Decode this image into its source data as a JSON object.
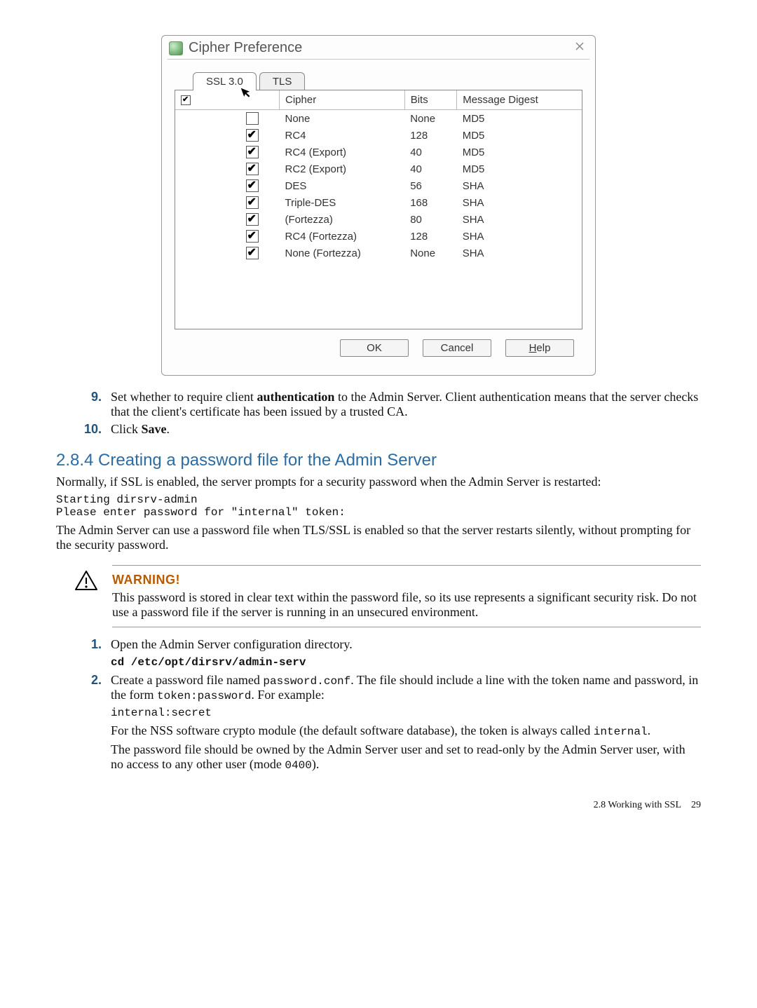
{
  "dialog": {
    "title": "Cipher Preference",
    "tabs": {
      "ssl": "SSL 3.0",
      "tls": "TLS"
    },
    "headers": {
      "select": "✓",
      "cipher": "Cipher",
      "bits": "Bits",
      "digest": "Message Digest"
    },
    "rows": [
      {
        "checked": false,
        "cipher": "None",
        "bits": "None",
        "digest": "MD5"
      },
      {
        "checked": true,
        "cipher": "RC4",
        "bits": "128",
        "digest": "MD5"
      },
      {
        "checked": true,
        "cipher": "RC4 (Export)",
        "bits": "40",
        "digest": "MD5"
      },
      {
        "checked": true,
        "cipher": "RC2 (Export)",
        "bits": "40",
        "digest": "MD5"
      },
      {
        "checked": true,
        "cipher": "DES",
        "bits": "56",
        "digest": "SHA"
      },
      {
        "checked": true,
        "cipher": "Triple-DES",
        "bits": "168",
        "digest": "SHA"
      },
      {
        "checked": true,
        "cipher": "(Fortezza)",
        "bits": "80",
        "digest": "SHA"
      },
      {
        "checked": true,
        "cipher": "RC4 (Fortezza)",
        "bits": "128",
        "digest": "SHA"
      },
      {
        "checked": true,
        "cipher": "None (Fortezza)",
        "bits": "None",
        "digest": "SHA"
      }
    ],
    "buttons": {
      "ok": "OK",
      "cancel": "Cancel",
      "help_pre": "H",
      "help_post": "elp"
    }
  },
  "steps_top": [
    {
      "n": "9.",
      "text_a": "Set whether to require client ",
      "bold": "authentication",
      "text_b": " to the Admin Server. Client authentication means that the server checks that the client's certificate has been issued by a trusted CA."
    },
    {
      "n": "10.",
      "text_a": "Click ",
      "bold": "Save",
      "text_b": "."
    }
  ],
  "section_title": "2.8.4 Creating a password file for the Admin Server",
  "para1": "Normally, if SSL is enabled, the server prompts for a security password when the Admin Server is restarted:",
  "code1": "Starting dirsrv-admin\nPlease enter password for \"internal\" token:",
  "para2": "The Admin Server can use a password file when TLS/SSL is enabled so that the server restarts silently, without prompting for the security password.",
  "warning": {
    "title": "WARNING!",
    "text": "This password is stored in clear text within the password file, so its use represents a significant security risk. Do not use a password file if the server is running in an unsecured environment."
  },
  "step1_text": "Open the Admin Server configuration directory.",
  "step1_code": "cd /etc/opt/dirsrv/admin-serv",
  "step2_a": "Create a password file named ",
  "step2_code1": "password.conf",
  "step2_b": ". The file should include a line with the token name and password, in the form ",
  "step2_code2": "token:password",
  "step2_c": ". For example:",
  "step2_example": "internal:secret",
  "step2_para2a": "For the NSS software crypto module (the default software database), the token is always called ",
  "step2_para2code": "internal",
  "step2_para3a": "The password file should be owned by the Admin Server user and set to read-only by the Admin Server user, with no access to any other user (mode ",
  "step2_para3code": "0400",
  "step2_para3b": ").",
  "footer": {
    "section": "2.8 Working with SSL",
    "page": "29"
  }
}
